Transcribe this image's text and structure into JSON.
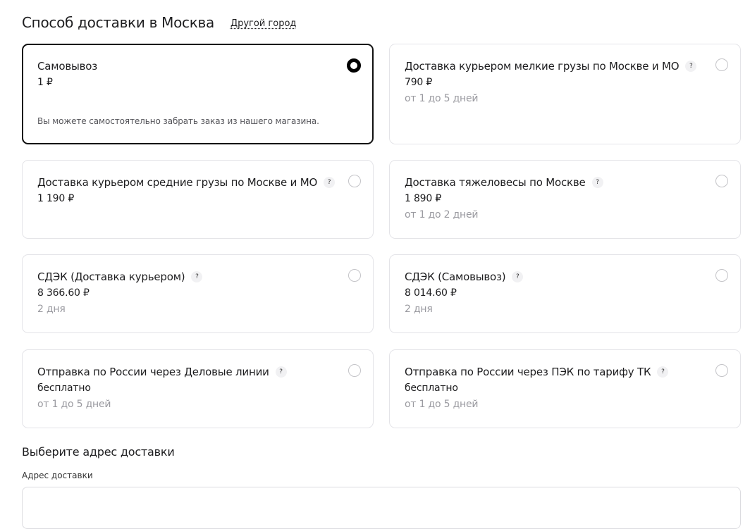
{
  "header": {
    "title": "Способ доставки в Москва",
    "other_city": "Другой город"
  },
  "options": [
    {
      "title": "Самовывоз",
      "price": "1 ₽",
      "days": "",
      "note": "Вы можете самостоятельно забрать заказ из нашего магазина.",
      "selected": true,
      "help_icon": ""
    },
    {
      "title": "Доставка курьером мелкие грузы по Москве и МО",
      "price": "790 ₽",
      "days": "от 1 до 5 дней",
      "selected": false,
      "help_icon": "?"
    },
    {
      "title": "Доставка курьером средние грузы по Москве и МО",
      "price": "1 190 ₽",
      "days": "",
      "selected": false,
      "help_icon": "?"
    },
    {
      "title": "Доставка тяжеловесы по Москве",
      "price": "1 890 ₽",
      "days": "от 1 до 2 дней",
      "selected": false,
      "help_icon": "?"
    },
    {
      "title": "СДЭК (Доставка курьером)",
      "price": "8 366.60 ₽",
      "days": "2 дня",
      "selected": false,
      "help_icon": "?"
    },
    {
      "title": "СДЭК (Самовывоз)",
      "price": "8 014.60 ₽",
      "days": "2 дня",
      "selected": false,
      "help_icon": "?"
    },
    {
      "title": "Отправка по России через Деловые линии",
      "price": "бесплатно",
      "days": "от 1 до 5 дней",
      "selected": false,
      "help_icon": "?"
    },
    {
      "title": "Отправка по России через ПЭК по тарифу ТК",
      "price": "бесплатно",
      "days": "от 1 до 5 дней",
      "selected": false,
      "help_icon": "?"
    }
  ],
  "address": {
    "section_title": "Выберите адрес доставки",
    "label": "Адрес доставки",
    "value": ""
  },
  "colors": {
    "selected_border": "#111111",
    "card_border": "#e4e4e8",
    "muted_text": "#9a9aa0"
  }
}
